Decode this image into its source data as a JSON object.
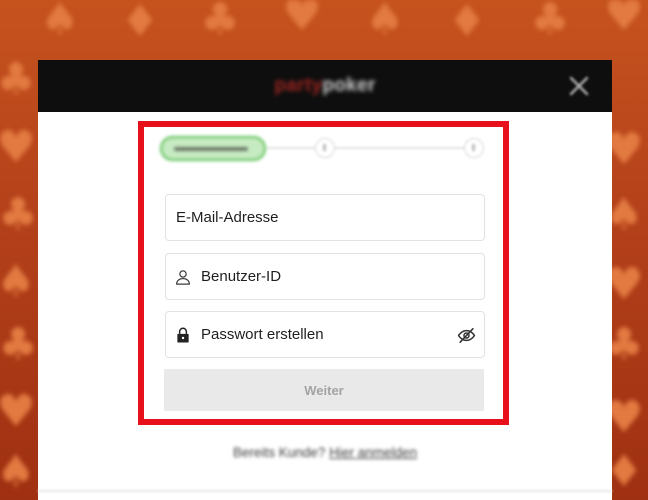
{
  "theme": {
    "background_top": "#c6531e",
    "background_bottom": "#9f3011",
    "suit_color": "#e27a41",
    "header_background": "#0e0e0e",
    "highlight_color": "#e8101a",
    "step_active_color": "#5fc25a",
    "button_background": "#e9e9e9",
    "button_text": "#a3a3a3"
  },
  "background": {
    "pattern_icons": [
      "spade-icon",
      "diamond-icon",
      "club-icon",
      "heart-icon"
    ]
  },
  "header": {
    "logo_part1": "party",
    "logo_part2": "poker",
    "close_icon": "close-icon"
  },
  "stepper": {
    "step_count": 3,
    "active_step": 1
  },
  "form": {
    "email": {
      "placeholder": "E-Mail-Adresse"
    },
    "username": {
      "placeholder": "Benutzer-ID",
      "icon": "person-icon"
    },
    "password": {
      "placeholder": "Passwort erstellen",
      "icon": "lock-icon",
      "visibility_icon": "eye-slash-icon"
    },
    "submit_label": "Weiter"
  },
  "footer": {
    "prompt": "Bereits Kunde?",
    "link_label": "Hier anmelden"
  }
}
